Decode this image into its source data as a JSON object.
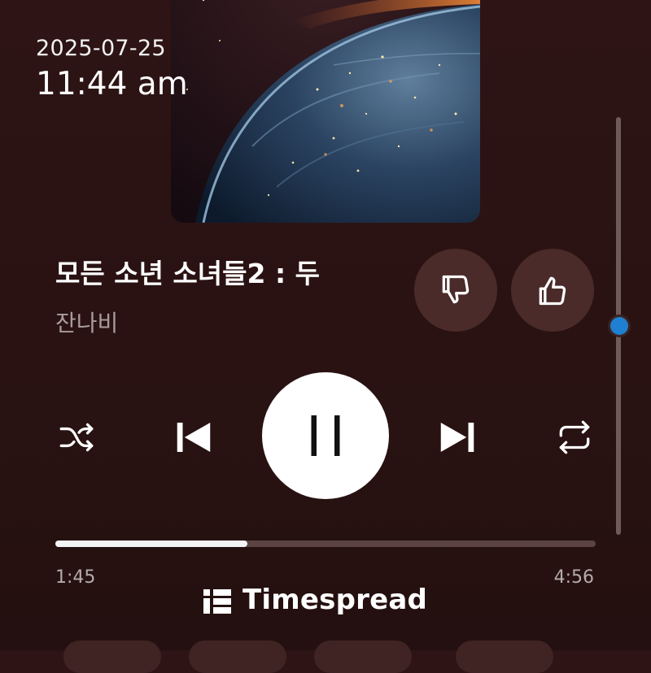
{
  "status": {
    "date": "2025-07-25",
    "time": "11:44 am"
  },
  "track": {
    "title": "모든 소년 소녀들2 : 두",
    "artist": "잔나비",
    "elapsed": "1:45",
    "duration": "4:56",
    "progress": 0.355
  },
  "controls": {
    "dislike_icon": "thumbs-down-icon",
    "like_icon": "thumbs-up-icon",
    "shuffle_icon": "shuffle-icon",
    "prev_icon": "skip-previous-icon",
    "play_state_icon": "pause-icon",
    "next_icon": "skip-next-icon",
    "repeat_icon": "repeat-icon"
  },
  "brand": {
    "name": "Timespread",
    "logo_icon": "timespread-logo-icon"
  },
  "colors": {
    "background": "#2a1212",
    "circle_button": "#4a2b2a",
    "progress_fill": "#f4f4f4",
    "progress_track": "#5a4342",
    "scroll_thumb": "#1f7fd0",
    "secondary_text": "#a89d9b"
  }
}
